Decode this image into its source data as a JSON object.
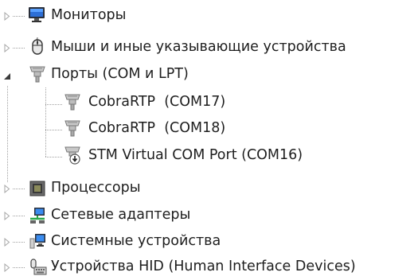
{
  "tree": {
    "items": [
      {
        "label": "Мониторы",
        "icon": "monitor-icon",
        "expander": "collapsed"
      },
      {
        "label": "Мыши и иные указывающие устройства",
        "icon": "mouse-icon",
        "expander": "collapsed"
      },
      {
        "label": "Порты (COM и LPT)",
        "icon": "port-icon",
        "expander": "expanded",
        "children": [
          {
            "label": "CobraRTP  (COM17)",
            "icon": "port-icon"
          },
          {
            "label": "CobraRTP  (COM18)",
            "icon": "port-icon"
          },
          {
            "label": "STM Virtual COM Port (COM16)",
            "icon": "port-warning-icon"
          }
        ]
      },
      {
        "label": "Процессоры",
        "icon": "processor-icon",
        "expander": "collapsed"
      },
      {
        "label": "Сетевые адаптеры",
        "icon": "network-adapter-icon",
        "expander": "collapsed"
      },
      {
        "label": "Системные устройства",
        "icon": "system-device-icon",
        "expander": "collapsed"
      },
      {
        "label": "Устройства HID (Human Interface Devices)",
        "icon": "hid-icon",
        "expander": "collapsed"
      }
    ]
  },
  "colors": {
    "text": "#1e1e1e",
    "expander_collapsed": "#a6a6a6",
    "expander_expanded": "#3c3c3c",
    "tree_lines": "#a0a0a0"
  }
}
